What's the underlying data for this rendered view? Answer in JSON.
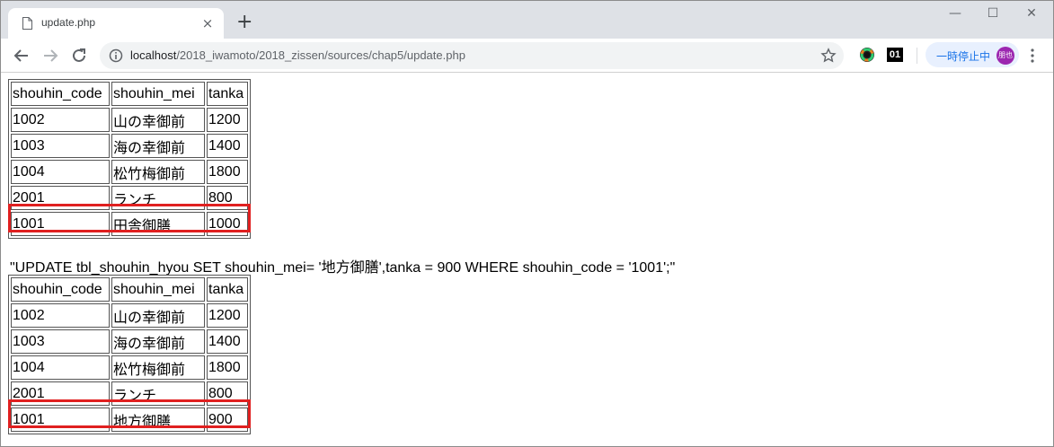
{
  "tab": {
    "title": "update.php",
    "close": "×",
    "new_tab": "+"
  },
  "window_controls": {
    "minimize": "—",
    "maximize": "☐",
    "close": "✕"
  },
  "address_bar": {
    "url_host": "localhost",
    "url_path": "/2018_iwamoto/2018_zissen/sources/chap5/update.php"
  },
  "extensions": {
    "ext2_label": "01"
  },
  "profile": {
    "status": "一時停止中",
    "avatar": "朋也"
  },
  "table_before": {
    "headers": [
      "shouhin_code",
      "shouhin_mei",
      "tanka"
    ],
    "rows": [
      [
        "1002",
        "山の幸御前",
        "1200"
      ],
      [
        "1003",
        "海の幸御前",
        "1400"
      ],
      [
        "1004",
        "松竹梅御前",
        "1800"
      ],
      [
        "2001",
        "ランチ",
        "800"
      ],
      [
        "1001",
        "田舎御膳",
        "1000"
      ]
    ]
  },
  "sql_statement": "\"UPDATE tbl_shouhin_hyou SET shouhin_mei= '地方御膳',tanka = 900 WHERE shouhin_code = '1001';\"",
  "table_after": {
    "headers": [
      "shouhin_code",
      "shouhin_mei",
      "tanka"
    ],
    "rows": [
      [
        "1002",
        "山の幸御前",
        "1200"
      ],
      [
        "1003",
        "海の幸御前",
        "1400"
      ],
      [
        "1004",
        "松竹梅御前",
        "1800"
      ],
      [
        "2001",
        "ランチ",
        "800"
      ],
      [
        "1001",
        "地方御膳",
        "900"
      ]
    ]
  },
  "colors": {
    "highlight": "#e02020",
    "tabstrip": "#dee1e6",
    "omnibox": "#f1f3f4"
  }
}
